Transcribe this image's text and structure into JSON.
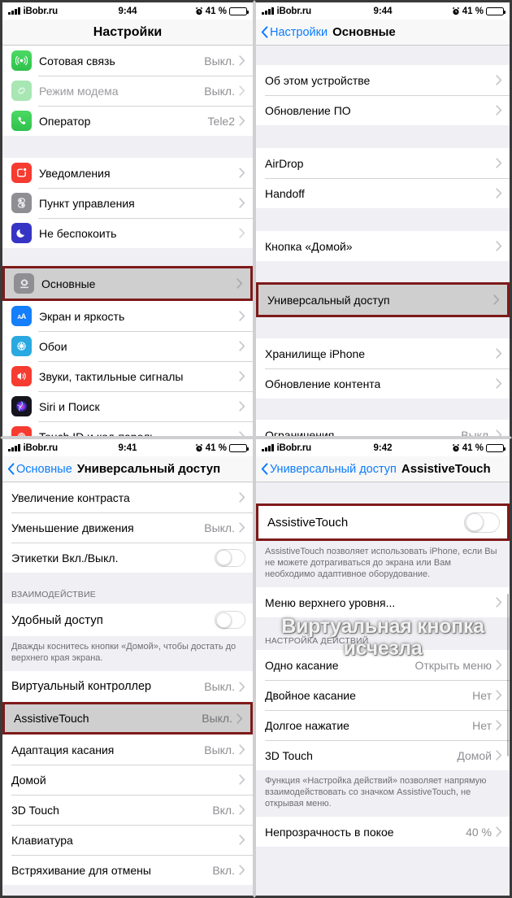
{
  "panels": {
    "settings": {
      "status": {
        "carrier": "iBobr.ru",
        "time": "9:44",
        "battery_pct": "41 %",
        "alarm": "alarm-icon"
      },
      "nav": {
        "title": "Настройки"
      },
      "rows_group1": [
        {
          "icon": "cellular-icon",
          "label": "Сотовая связь",
          "value": "Выкл.",
          "chevron": true,
          "dim": false
        },
        {
          "icon": "hotspot-icon",
          "label": "Режим модема",
          "value": "Выкл.",
          "chevron": true,
          "dim": true
        },
        {
          "icon": "phone-icon",
          "label": "Оператор",
          "value": "Tele2",
          "chevron": true,
          "dim": false
        }
      ],
      "rows_group2": [
        {
          "icon": "notifications-icon",
          "label": "Уведомления",
          "value": "",
          "chevron": true,
          "dim": false
        },
        {
          "icon": "control-center-icon",
          "label": "Пункт управления",
          "value": "",
          "chevron": true,
          "dim": false
        },
        {
          "icon": "moon-icon",
          "label": "Не беспокоить",
          "value": "",
          "chevron": true,
          "dim": true
        }
      ],
      "highlighted_row": {
        "icon": "gear-icon",
        "label": "Основные",
        "value": "",
        "chevron": true
      },
      "rows_group3": [
        {
          "icon": "display-icon",
          "label": "Экран и яркость",
          "value": "",
          "chevron": true,
          "dim": false
        },
        {
          "icon": "wallpaper-icon",
          "label": "Обои",
          "value": "",
          "chevron": true,
          "dim": false
        },
        {
          "icon": "sounds-icon",
          "label": "Звуки, тактильные сигналы",
          "value": "",
          "chevron": true,
          "dim": false
        },
        {
          "icon": "siri-icon",
          "label": "Siri и Поиск",
          "value": "",
          "chevron": true,
          "dim": false
        },
        {
          "icon": "touchid-icon",
          "label": "Touch ID и код-пароль",
          "value": "",
          "chevron": true,
          "dim": false
        }
      ]
    },
    "general": {
      "status": {
        "carrier": "iBobr.ru",
        "time": "9:44",
        "battery_pct": "41 %",
        "alarm": "alarm-icon"
      },
      "nav": {
        "back": "Настройки",
        "title": "Основные"
      },
      "rows_group1": [
        {
          "label": "Об этом устройстве",
          "value": "",
          "chevron": true
        },
        {
          "label": "Обновление ПО",
          "value": "",
          "chevron": true
        }
      ],
      "rows_group2": [
        {
          "label": "AirDrop",
          "value": "",
          "chevron": true
        },
        {
          "label": "Handoff",
          "value": "",
          "chevron": true
        }
      ],
      "rows_group3": [
        {
          "label": "Кнопка «Домой»",
          "value": "",
          "chevron": true
        }
      ],
      "highlighted_row": {
        "label": "Универсальный доступ",
        "value": "",
        "chevron": true
      },
      "rows_group4": [
        {
          "label": "Хранилище iPhone",
          "value": "",
          "chevron": true
        },
        {
          "label": "Обновление контента",
          "value": "",
          "chevron": true
        }
      ],
      "rows_group5": [
        {
          "label": "Ограничения",
          "value": "Выкл.",
          "chevron": true
        }
      ]
    },
    "accessibility": {
      "status": {
        "carrier": "iBobr.ru",
        "time": "9:41",
        "battery_pct": "41 %",
        "alarm": "alarm-icon"
      },
      "nav": {
        "back": "Основные",
        "title": "Универсальный доступ"
      },
      "rows_group1": [
        {
          "label": "Увеличение контраста",
          "value": "",
          "chevron": true,
          "toggle": false
        },
        {
          "label": "Уменьшение движения",
          "value": "Выкл.",
          "chevron": true,
          "toggle": false
        },
        {
          "label": "Этикетки Вкл./Выкл.",
          "value": "",
          "chevron": false,
          "toggle": true
        }
      ],
      "section_header": "ВЗАИМОДЕЙСТВИЕ",
      "rows_group2": [
        {
          "label": "Удобный доступ",
          "value": "",
          "chevron": false,
          "toggle": true
        }
      ],
      "footnote": "Дважды коснитесь кнопки «Домой», чтобы достать до верхнего края экрана.",
      "rows_group3": [
        {
          "label": "Виртуальный контроллер",
          "value": "Выкл.",
          "chevron": true,
          "toggle": false
        }
      ],
      "highlighted_row": {
        "label": "AssistiveTouch",
        "value": "Выкл.",
        "chevron": true
      },
      "rows_group4": [
        {
          "label": "Адаптация касания",
          "value": "Выкл.",
          "chevron": true,
          "toggle": false
        },
        {
          "label": "Домой",
          "value": "",
          "chevron": true,
          "toggle": false
        },
        {
          "label": "3D Touch",
          "value": "Вкл.",
          "chevron": true,
          "toggle": false
        },
        {
          "label": "Клавиатура",
          "value": "",
          "chevron": true,
          "toggle": false
        },
        {
          "label": "Встряхивание для отмены",
          "value": "Вкл.",
          "chevron": true,
          "toggle": false
        }
      ]
    },
    "assistivetouch": {
      "status": {
        "carrier": "iBobr.ru",
        "time": "9:42",
        "battery_pct": "41 %",
        "alarm": "alarm-icon"
      },
      "nav": {
        "back": "Универсальный доступ",
        "title": "AssistiveTouch"
      },
      "highlighted_row": {
        "label": "AssistiveTouch",
        "toggle": true,
        "toggle_on": false
      },
      "footnote": "AssistiveTouch позволяет использовать iPhone, если Вы не можете дотрагиваться до экрана или Вам необходимо адаптивное оборудование.",
      "rows_group1": [
        {
          "label": "Меню верхнего уровня...",
          "value": "",
          "chevron": true
        }
      ],
      "section_header": "НАСТРОЙКА ДЕЙСТВИЙ",
      "rows_group2": [
        {
          "label": "Одно касание",
          "value": "Открыть меню",
          "chevron": true
        },
        {
          "label": "Двойное касание",
          "value": "Нет",
          "chevron": true
        },
        {
          "label": "Долгое нажатие",
          "value": "Нет",
          "chevron": true
        },
        {
          "label": "3D Touch",
          "value": "Домой",
          "chevron": true
        }
      ],
      "footnote2": "Функция «Настройка действий» позволяет напрямую взаимодействовать со значком AssistiveTouch, не открывая меню.",
      "rows_group3": [
        {
          "label": "Непрозрачность в покое",
          "value": "40 %",
          "chevron": true
        }
      ],
      "watermark_line1": "Виртуальная кнопка",
      "watermark_line2": "исчезла"
    }
  },
  "colors": {
    "highlight_border": "#7e1a1a",
    "highlight_fill": "#cfcfcf",
    "link_blue": "#0a7cff",
    "battery_yellow": "#fdd835",
    "list_bg": "#efeff4"
  }
}
